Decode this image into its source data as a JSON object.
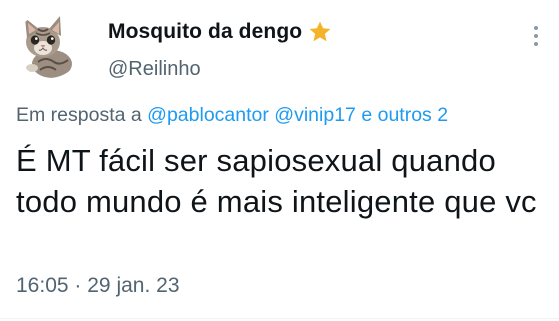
{
  "author": {
    "display_name": "Mosquito da dengo",
    "handle": "@Reilinho",
    "avatar_icon": "kitten-avatar",
    "badge_icon": "star-emoji",
    "badge_color": "#f4b42a"
  },
  "reply": {
    "prefix": "Em resposta a",
    "mentions": [
      "@pablocantor",
      "@vinip17"
    ],
    "connector": "e",
    "others": "outros 2"
  },
  "tweet": {
    "text": "É MT fácil ser sapiosexual quando todo mundo é mais inteligente que vc",
    "time": "16:05",
    "separator": "·",
    "date": "29 jan. 23"
  },
  "colors": {
    "text": "#0f1419",
    "secondary": "#536471",
    "link": "#1d9bf0"
  }
}
